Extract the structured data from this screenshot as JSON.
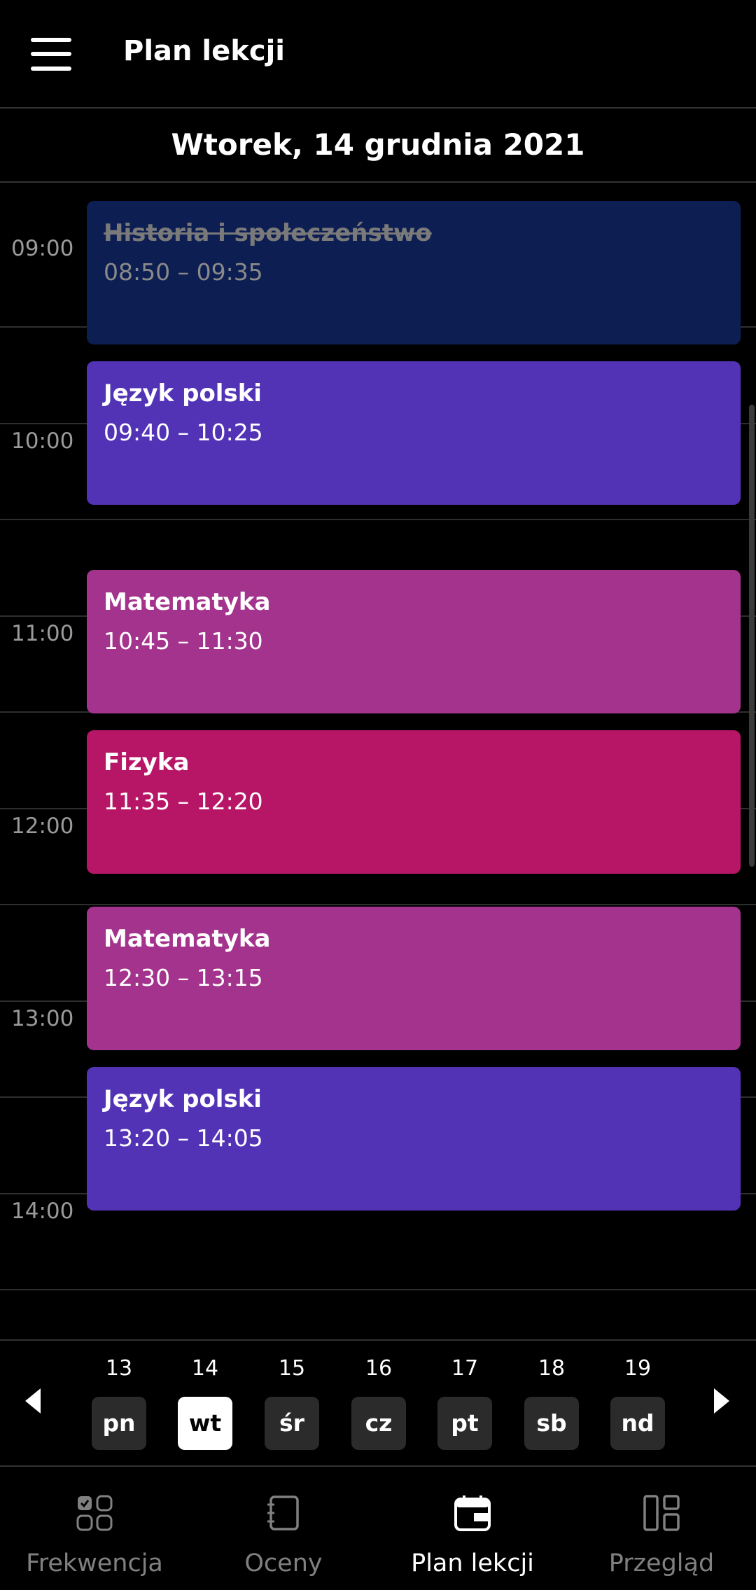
{
  "header": {
    "title": "Plan lekcji",
    "menu_icon": "hamburger-menu-icon"
  },
  "date_label": "Wtorek, 14 grudnia 2021",
  "hours": [
    "09:00",
    "10:00",
    "11:00",
    "12:00",
    "13:00",
    "14:00"
  ],
  "lessons": [
    {
      "subject": "Historia i społeczeństwo",
      "time": "08:50 – 09:35",
      "color": "#0c1e52",
      "cancelled": true
    },
    {
      "subject": "Język polski",
      "time": "09:40 – 10:25",
      "color": "#5233b6",
      "cancelled": false
    },
    {
      "subject": "Matematyka",
      "time": "10:45 – 11:30",
      "color": "#a3338c",
      "cancelled": false
    },
    {
      "subject": "Fizyka",
      "time": "11:35 – 12:20",
      "color": "#b71667",
      "cancelled": false
    },
    {
      "subject": "Matematyka",
      "time": "12:30 – 13:15",
      "color": "#a3338c",
      "cancelled": false
    },
    {
      "subject": "Język polski",
      "time": "13:20 – 14:05",
      "color": "#5233b6",
      "cancelled": false
    }
  ],
  "days": [
    {
      "num": "13",
      "abbr": "pn"
    },
    {
      "num": "14",
      "abbr": "wt",
      "selected": true
    },
    {
      "num": "15",
      "abbr": "śr"
    },
    {
      "num": "16",
      "abbr": "cz"
    },
    {
      "num": "17",
      "abbr": "pt"
    },
    {
      "num": "18",
      "abbr": "sb"
    },
    {
      "num": "19",
      "abbr": "nd"
    }
  ],
  "nav": [
    {
      "label": "Frekwencja",
      "icon": "attendance-grid-icon"
    },
    {
      "label": "Oceny",
      "icon": "grades-notebook-icon"
    },
    {
      "label": "Plan lekcji",
      "icon": "calendar-icon",
      "active": true
    },
    {
      "label": "Przegląd",
      "icon": "dashboard-icon"
    }
  ]
}
